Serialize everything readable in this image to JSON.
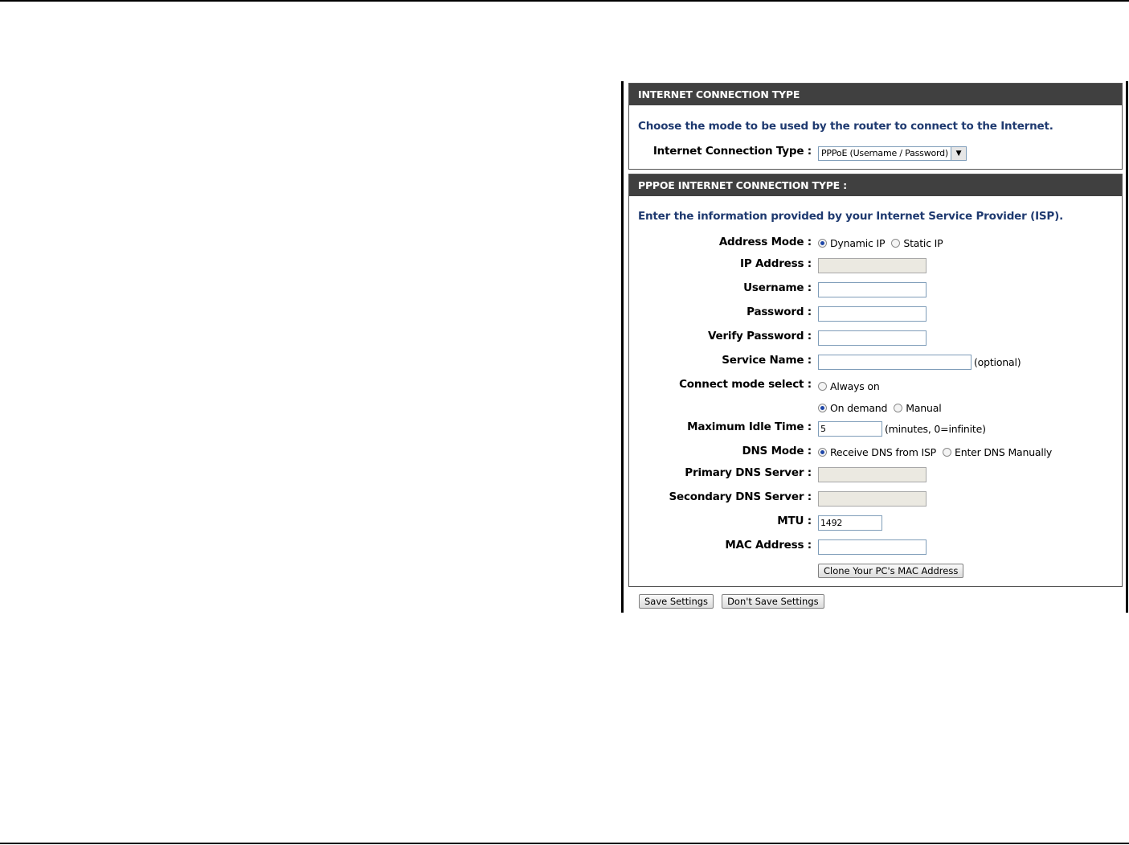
{
  "section1": {
    "header": "INTERNET CONNECTION TYPE",
    "intro": "Choose the mode to be used by the router to connect to the Internet.",
    "connection_type_label": "Internet Connection Type :",
    "connection_type_value": "PPPoE (Username / Password)"
  },
  "section2": {
    "header": "PPPOE INTERNET CONNECTION TYPE :",
    "intro": "Enter the information provided by your Internet Service Provider (ISP).",
    "address_mode": {
      "label": "Address Mode :",
      "options": [
        "Dynamic IP",
        "Static IP"
      ],
      "selected": "Dynamic IP"
    },
    "ip_address": {
      "label": "IP Address :",
      "value": ""
    },
    "username": {
      "label": "Username :",
      "value": ""
    },
    "password": {
      "label": "Password :",
      "value": ""
    },
    "verify_password": {
      "label": "Verify Password :",
      "value": ""
    },
    "service_name": {
      "label": "Service Name :",
      "value": "",
      "suffix": "(optional)"
    },
    "connect_mode": {
      "label": "Connect mode select :",
      "options": [
        "Always on",
        "On demand",
        "Manual"
      ],
      "selected": "On demand"
    },
    "max_idle_time": {
      "label": "Maximum Idle Time :",
      "value": "5",
      "suffix": "(minutes, 0=infinite)"
    },
    "dns_mode": {
      "label": "DNS Mode :",
      "options": [
        "Receive DNS from ISP",
        "Enter DNS Manually"
      ],
      "selected": "Receive DNS from ISP"
    },
    "primary_dns": {
      "label": "Primary DNS Server :",
      "value": ""
    },
    "secondary_dns": {
      "label": "Secondary DNS Server :",
      "value": ""
    },
    "mtu": {
      "label": "MTU :",
      "value": "1492"
    },
    "mac_address": {
      "label": "MAC Address :",
      "value": ""
    },
    "clone_mac_button": "Clone Your PC's MAC Address"
  },
  "buttons": {
    "save": "Save Settings",
    "dont_save": "Don't Save Settings"
  },
  "colors": {
    "header_bg": "#404040",
    "intro_text": "#1f3a70",
    "disabled_field": "#ebe9e1"
  }
}
